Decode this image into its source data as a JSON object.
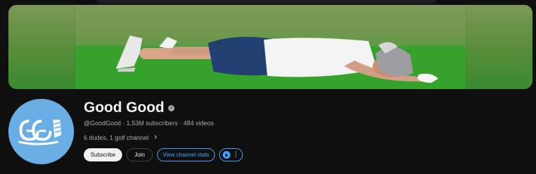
{
  "channel": {
    "name": "Good Good",
    "verified_icon": "verified-check-icon",
    "handle": "@GoodGood",
    "subscribers": "1.53M subscribers",
    "videos": "484 videos",
    "separator": "·",
    "description": "6 dudes, 1 golf channel",
    "more_icon": "chevron-right-icon"
  },
  "actions": {
    "subscribe": "Subscribe",
    "join": "Join",
    "stats": "View channel stats",
    "extension_icon": "extension-play-icon",
    "more_icon": "more-vert-icon"
  },
  "colors": {
    "background": "#0f0f0f",
    "accent_blue": "#3ea6ff",
    "avatar_bg": "#6aaee6"
  }
}
